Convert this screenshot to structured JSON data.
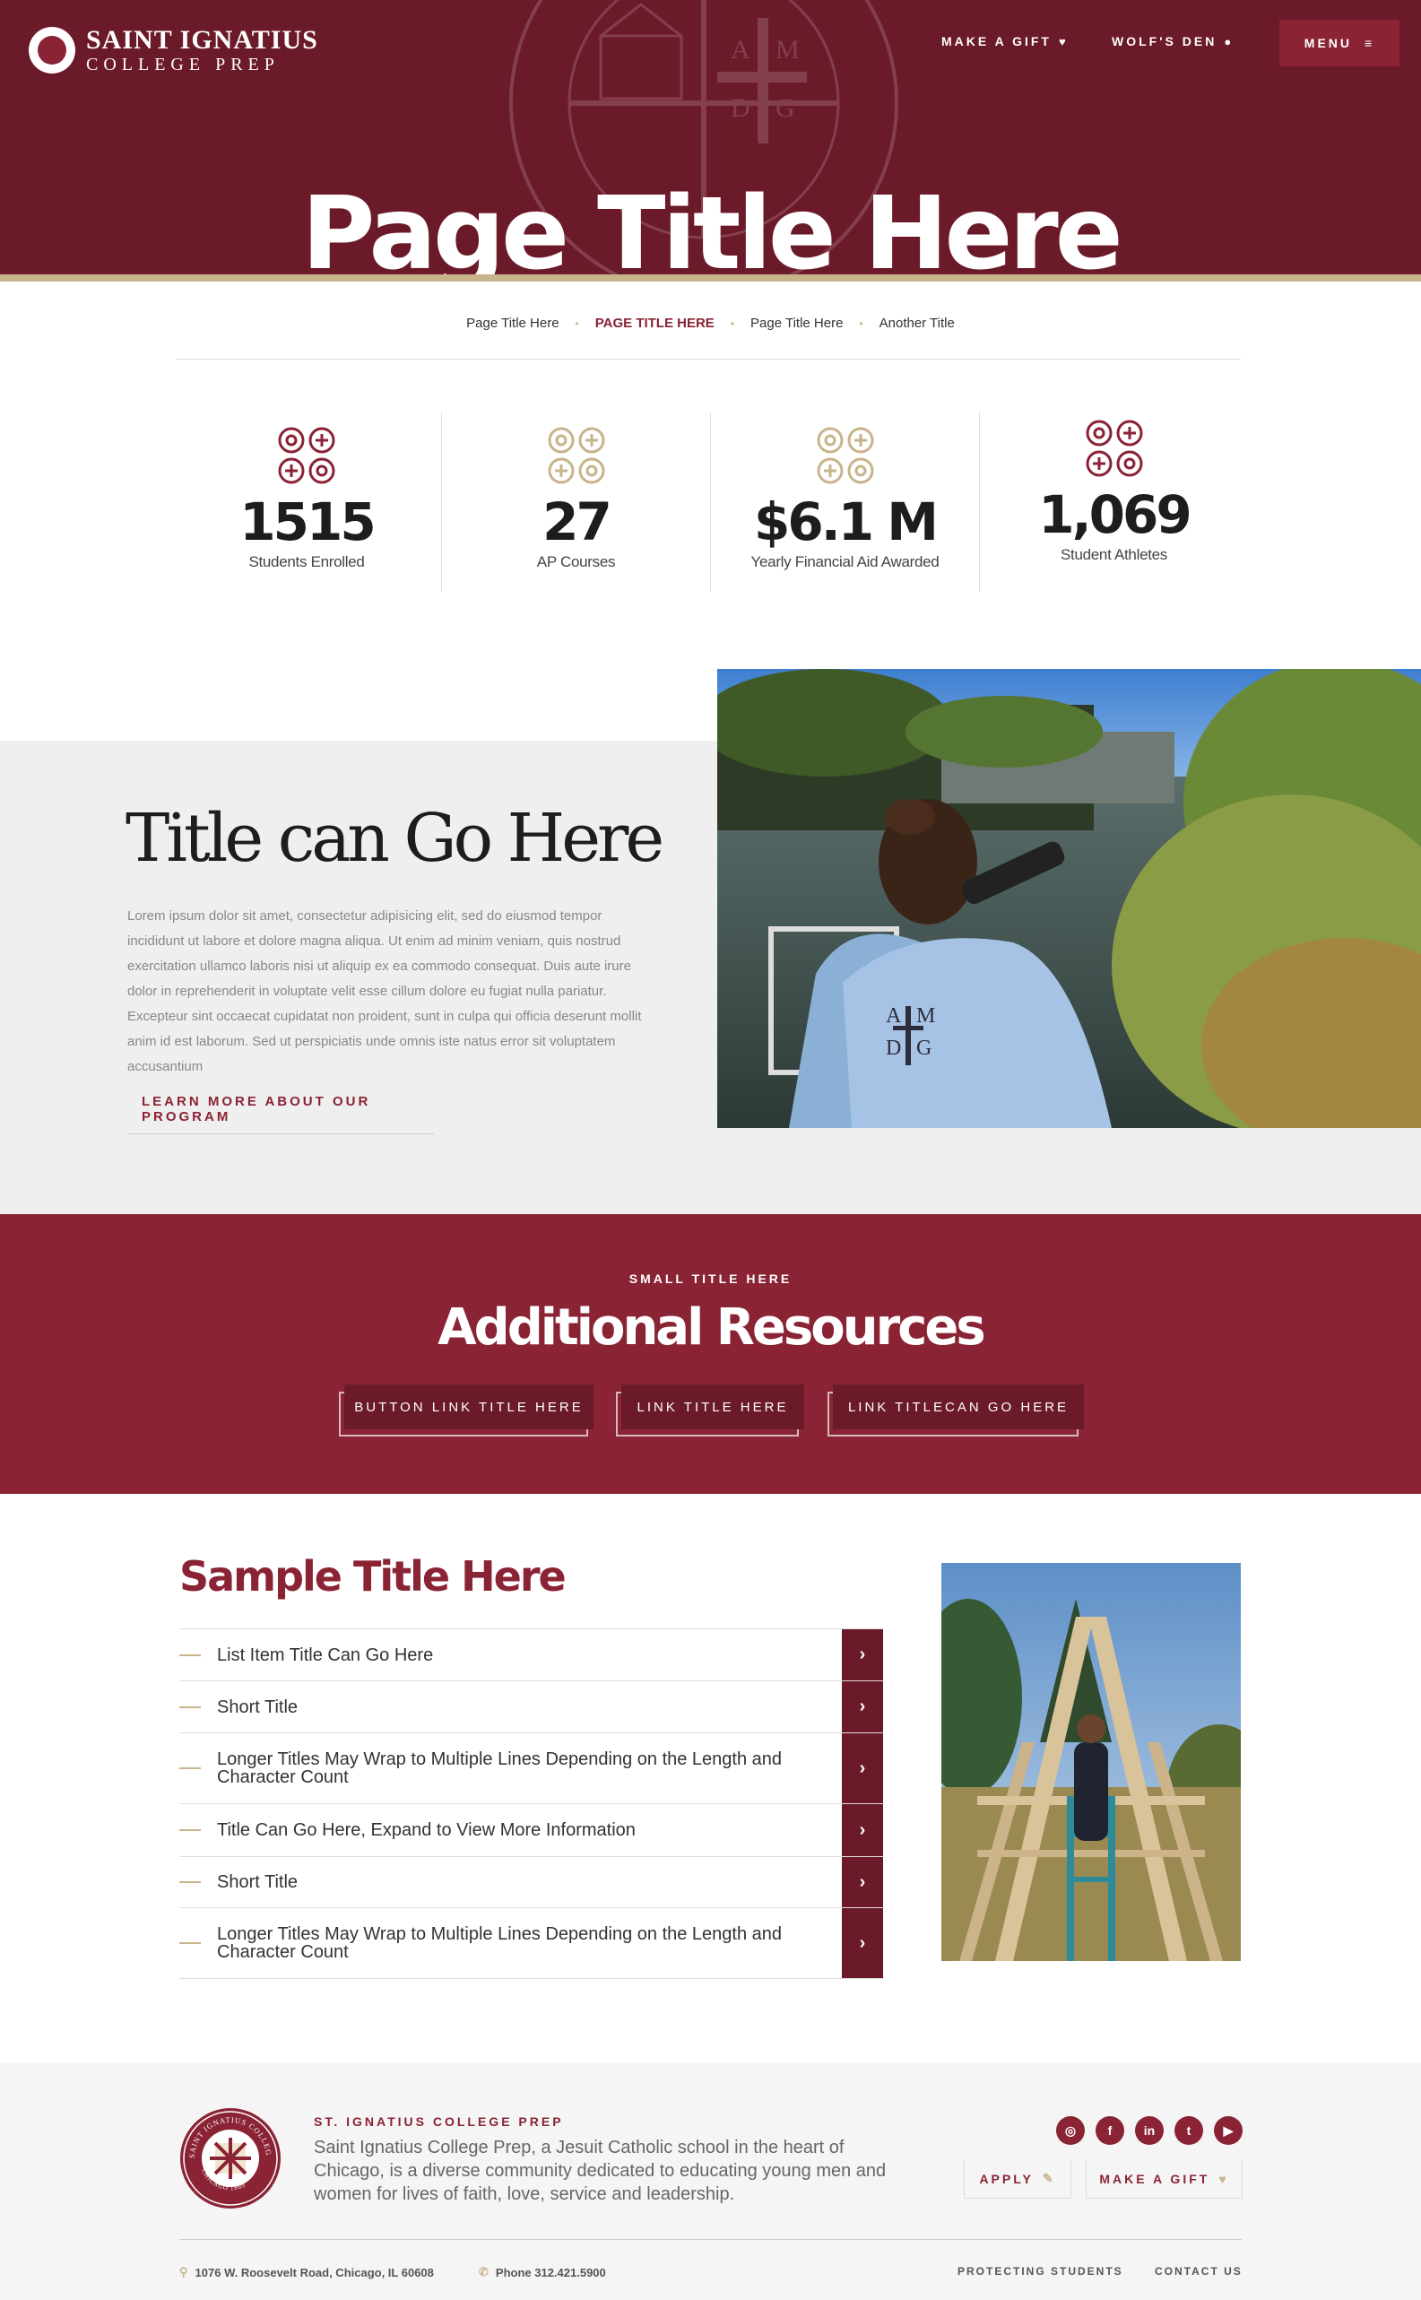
{
  "header": {
    "logo_line1": "SAINT IGNATIUS",
    "logo_line2": "COLLEGE PREP",
    "nav": {
      "gift_label": "MAKE A GIFT",
      "gift_icon": "heart-icon",
      "den_label": "WOLF'S DEN",
      "den_icon": "user-icon",
      "menu_label": "MENU",
      "menu_icon": "hamburger-icon"
    },
    "page_title": "Page Title Here",
    "seal_letters": [
      "A",
      "M",
      "D",
      "G"
    ],
    "seal_text": "SAINT IGNATIUS COLLEGE PREP"
  },
  "breadcrumbs": [
    {
      "label": "Page Title Here",
      "active": false
    },
    {
      "label": "PAGE TITLE HERE",
      "active": true
    },
    {
      "label": "Page Title Here",
      "active": false
    },
    {
      "label": "Another Title",
      "active": false
    }
  ],
  "stats": [
    {
      "value": "1515",
      "label": "Students Enrolled",
      "icon": "quadrant-icon",
      "color": "#8a2334"
    },
    {
      "value": "27",
      "label": "AP Courses",
      "icon": "quadrant-icon",
      "color": "#c8b48a"
    },
    {
      "value": "$6.1 M",
      "label": "Yearly Financial Aid Awarded",
      "icon": "quadrant-icon",
      "color": "#c8b48a"
    },
    {
      "value": "1,069",
      "label": "Student Athletes",
      "icon": "quadrant-icon",
      "color": "#8a2334"
    }
  ],
  "feature": {
    "title": "Title can Go Here",
    "body": "Lorem ipsum dolor sit amet, consectetur adipisicing elit, sed do eiusmod tempor incididunt ut labore et dolore magna aliqua. Ut enim ad minim veniam, quis nostrud exercitation ullamco laboris nisi ut aliquip ex ea commodo consequat. Duis aute irure dolor in reprehenderit in voluptate velit esse cillum dolore eu fugiat nulla pariatur. Excepteur sint occaecat cupidatat non proident, sunt in culpa qui officia deserunt mollit anim id est laborum. Sed ut perspiciatis unde omnis iste natus error sit voluptatem accusantium",
    "link_label": "LEARN MORE ABOUT OUR PROGRAM",
    "shirt_letters": [
      "A",
      "M",
      "D",
      "G"
    ]
  },
  "resources": {
    "small_title": "SMALL TITLE HERE",
    "title": "Additional Resources",
    "buttons": [
      "BUTTON LINK TITLE HERE",
      "LINK TITLE HERE",
      "LINK TITLECAN GO  HERE"
    ]
  },
  "list_section": {
    "title": "Sample Title Here",
    "items": [
      "List Item Title Can Go Here",
      "Short Title",
      "Longer Titles May Wrap to Multiple Lines Depending on the Length and Character Count",
      "Title Can Go Here, Expand to View More Information",
      "Short Title",
      "Longer Titles May Wrap to Multiple Lines Depending on the Length and Character Count"
    ],
    "arrow_icon": "chevron-right-icon"
  },
  "footer": {
    "name": "ST. IGNATIUS COLLEGE PREP",
    "about": "Saint Ignatius College Prep, a Jesuit Catholic school in the heart of Chicago, is a diverse community dedicated to educating young men and women for lives of faith, love, service and leadership.",
    "seal_text": "SAINT IGNATIUS COLLEGE PREP",
    "seal_subtext": "CHICAGO 1869",
    "socials": [
      {
        "icon": "instagram-icon",
        "glyph": "◎"
      },
      {
        "icon": "facebook-icon",
        "glyph": "f"
      },
      {
        "icon": "linkedin-icon",
        "glyph": "in"
      },
      {
        "icon": "twitter-icon",
        "glyph": "t"
      },
      {
        "icon": "youtube-icon",
        "glyph": "▶"
      }
    ],
    "apply_label": "APPLY",
    "apply_icon": "pencil-icon",
    "gift_label": "MAKE A GIFT",
    "gift_icon": "heart-icon",
    "address": "1076 W. Roosevelt Road, Chicago, IL 60608",
    "address_icon": "map-pin-icon",
    "phone": "Phone 312.421.5900",
    "phone_icon": "phone-icon",
    "links": [
      "PROTECTING STUDENTS",
      "CONTACT US"
    ]
  },
  "colors": {
    "maroon_dark": "#6b1a29",
    "maroon": "#8a2334",
    "gold": "#c8b48a",
    "light_gray": "#efefef"
  }
}
